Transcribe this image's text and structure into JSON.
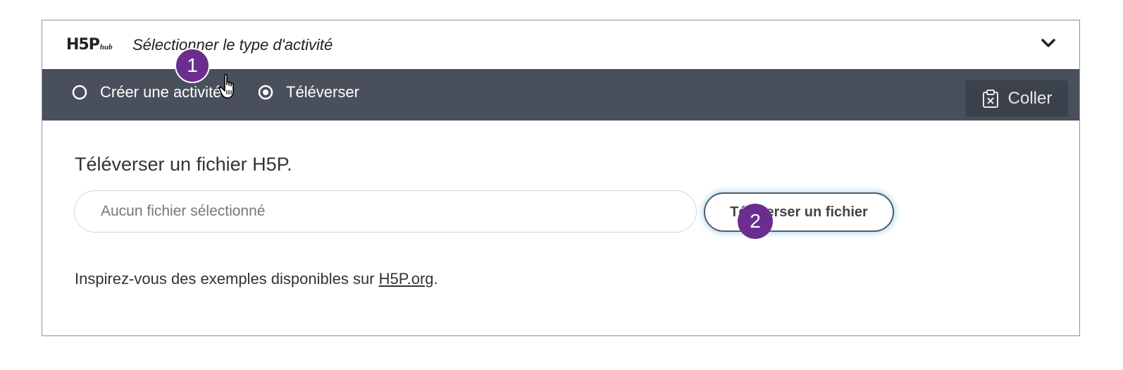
{
  "header": {
    "logo_main": "H5P",
    "logo_sub": "hub",
    "title": "Sélectionner le type d'activité",
    "chevron_icon": "chevron-down-icon"
  },
  "tabs": [
    {
      "label": "Créer une activité",
      "selected": false,
      "icon": "radio-empty-icon"
    },
    {
      "label": "Téléverser",
      "selected": true,
      "icon": "radio-selected-icon"
    }
  ],
  "paste": {
    "label": "Coller",
    "icon": "clipboard-icon"
  },
  "markers": [
    {
      "label": "1",
      "color": "#6b2e8f"
    },
    {
      "label": "2",
      "color": "#6b2e8f"
    }
  ],
  "upload": {
    "title": "Téléverser un fichier H5P.",
    "input_placeholder": "Aucun fichier sélectionné",
    "button_label": "Téléverser un fichier",
    "inspire_prefix": "Inspirez-vous des exemples disponibles sur ",
    "inspire_link": "H5P.org",
    "inspire_suffix": "."
  },
  "colors": {
    "tabbar_bg": "#4a505b",
    "paste_bg": "#3c424b",
    "marker": "#6b2e8f"
  }
}
